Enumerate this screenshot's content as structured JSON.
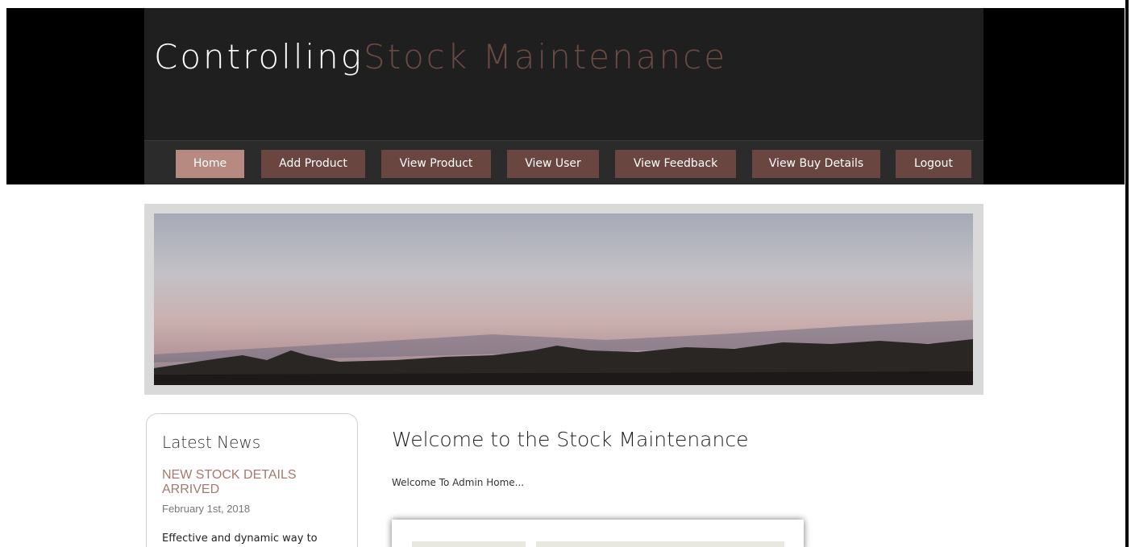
{
  "header": {
    "logo_part1": "Controlling",
    "logo_part2": "Stock Maintenance"
  },
  "nav": {
    "items": [
      {
        "label": "Home",
        "active": true
      },
      {
        "label": "Add Product",
        "active": false
      },
      {
        "label": "View Product",
        "active": false
      },
      {
        "label": "View User",
        "active": false
      },
      {
        "label": "View Feedback",
        "active": false
      },
      {
        "label": "View Buy Details",
        "active": false
      },
      {
        "label": "Logout",
        "active": false
      }
    ]
  },
  "sidebar": {
    "title": "Latest News",
    "news_title": "NEW STOCK DETAILS ARRIVED",
    "news_date": "February 1st, 2018",
    "news_body": "Effective and dynamic way to"
  },
  "main": {
    "title": "Welcome to the Stock Maintenance",
    "subtitle": "Welcome To Admin Home..."
  },
  "colors": {
    "accent": "#6a4640",
    "accent_active": "#b78a81",
    "news_title": "#a6786f",
    "header_bg": "#1f1f1f"
  }
}
